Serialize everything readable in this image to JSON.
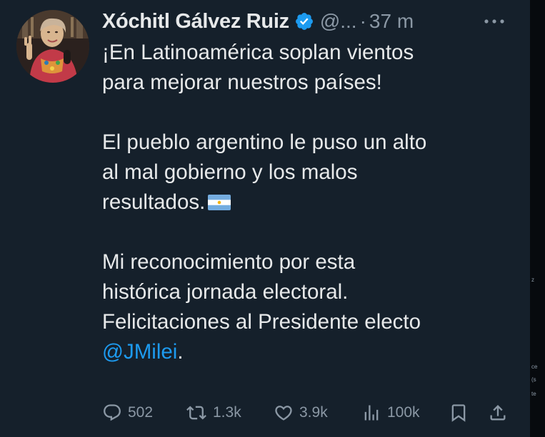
{
  "author": {
    "display_name": "Xóchitl Gálvez Ruiz",
    "handle": "@...",
    "verified": true
  },
  "timestamp": "37 m",
  "separator": "·",
  "tweet": {
    "line1": "¡En Latinoamérica soplan vientos",
    "line2": "para mejorar nuestros países!",
    "line3": "El pueblo argentino le puso un alto",
    "line4": "al mal gobierno y los malos",
    "line5": "resultados.",
    "line6": "Mi reconocimiento por esta",
    "line7": "histórica jornada electoral.",
    "line8": "Felicitaciones al Presidente electo",
    "mention": "@JMilei",
    "trailing": "."
  },
  "actions": {
    "replies": "502",
    "reposts": "1.3k",
    "likes": "3.9k",
    "views": "100k"
  },
  "colors": {
    "background": "#15202b",
    "text": "#e7e9ea",
    "muted": "#8b98a5",
    "accent": "#1d9bf0"
  },
  "icons": {
    "verified": "verified-badge-icon",
    "more": "more-horizontal-icon",
    "reply": "reply-icon",
    "repost": "repost-icon",
    "like": "heart-icon",
    "views": "views-chart-icon",
    "bookmark": "bookmark-icon",
    "share": "share-icon"
  },
  "side_fragments": {
    "a": "z",
    "b": "ce",
    "c": "(s",
    "d": "te"
  }
}
